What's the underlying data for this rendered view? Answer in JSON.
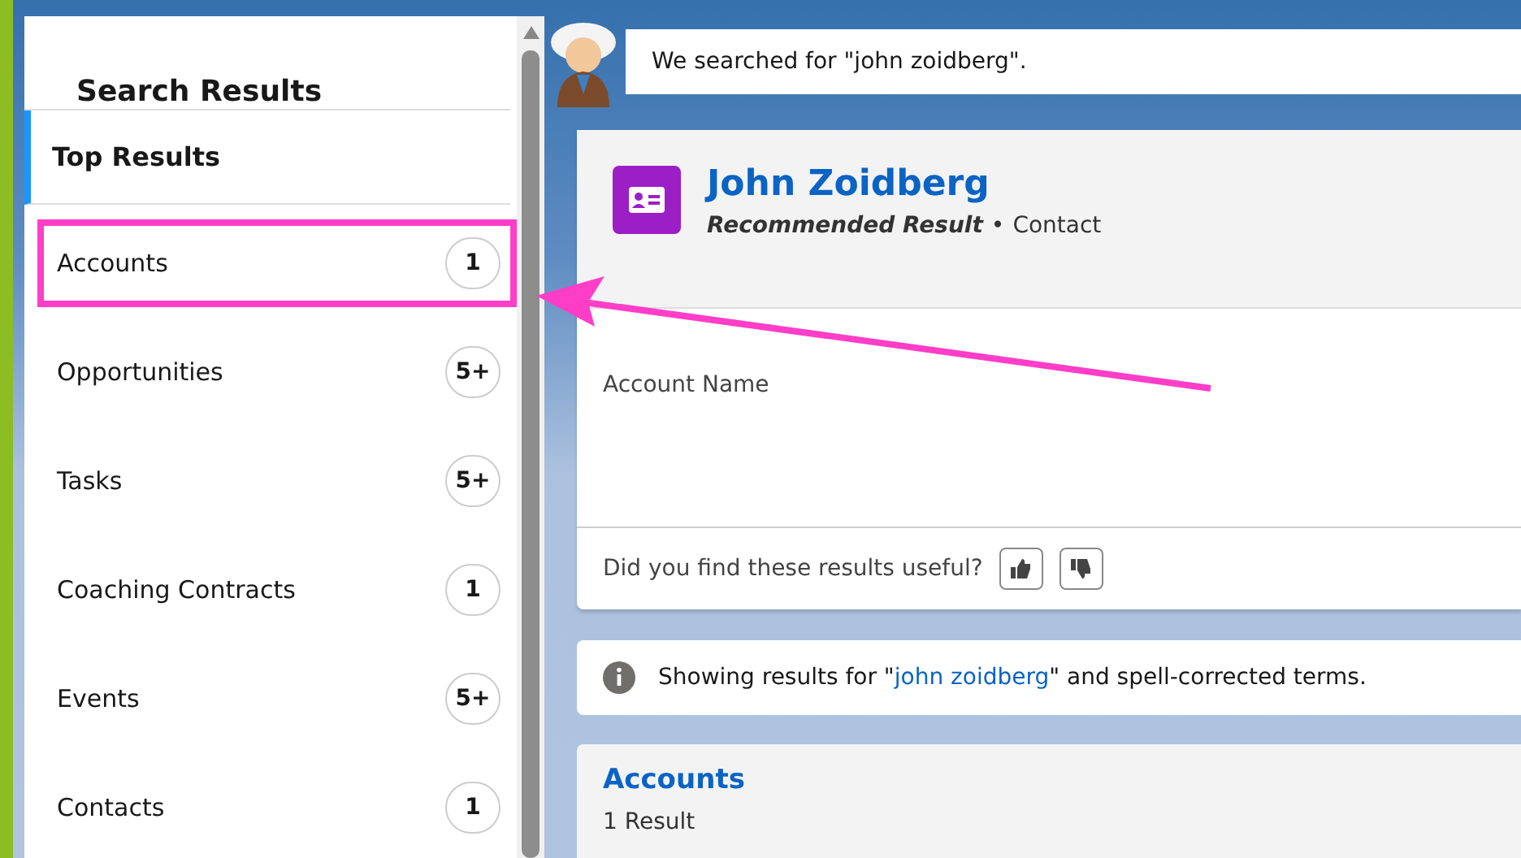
{
  "sidebar": {
    "title": "Search Results",
    "top_item": {
      "label": "Top Results",
      "selected": true
    },
    "items": [
      {
        "label": "Accounts",
        "count": "1",
        "selected": false,
        "highlighted": true
      },
      {
        "label": "Opportunities",
        "count": "5+",
        "selected": false,
        "highlighted": false
      },
      {
        "label": "Tasks",
        "count": "5+",
        "selected": false,
        "highlighted": false
      },
      {
        "label": "Coaching Contracts",
        "count": "1",
        "selected": false,
        "highlighted": false
      },
      {
        "label": "Events",
        "count": "5+",
        "selected": false,
        "highlighted": false
      },
      {
        "label": "Contacts",
        "count": "1",
        "selected": false,
        "highlighted": false
      }
    ]
  },
  "search_banner": {
    "text": "We searched for \"john zoidberg\"."
  },
  "top_result": {
    "name": "John Zoidberg",
    "tag": "Recommended Result",
    "separator": "•",
    "type": "Contact",
    "field_label": "Account Name",
    "feedback_question": "Did you find these results useful?"
  },
  "spell_notice": {
    "prefix": "Showing results for \"",
    "link": "john zoidberg",
    "suffix": "\" and spell-corrected terms."
  },
  "accounts_section": {
    "title": "Accounts",
    "count": "1 Result"
  }
}
